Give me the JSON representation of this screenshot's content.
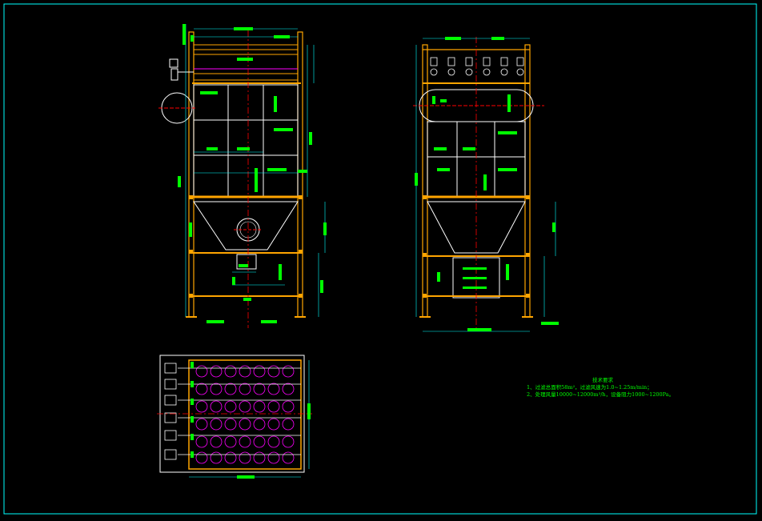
{
  "notes": {
    "title": "技术要求",
    "line1": "1、过滤总面积58m²，过滤风速为1.0~1.25m/min；",
    "line2": "2、处理风量10000~12000m³/h，设备阻力1000~1200Pa。"
  },
  "colors": {
    "background": "#000000",
    "border": "#00ffff",
    "structure": "#ffa500",
    "dimension": "#00ffff",
    "label_fill": "#00ff00",
    "centerline": "#ff0000",
    "outline": "#ffffff",
    "bag": "#ff00ff"
  }
}
